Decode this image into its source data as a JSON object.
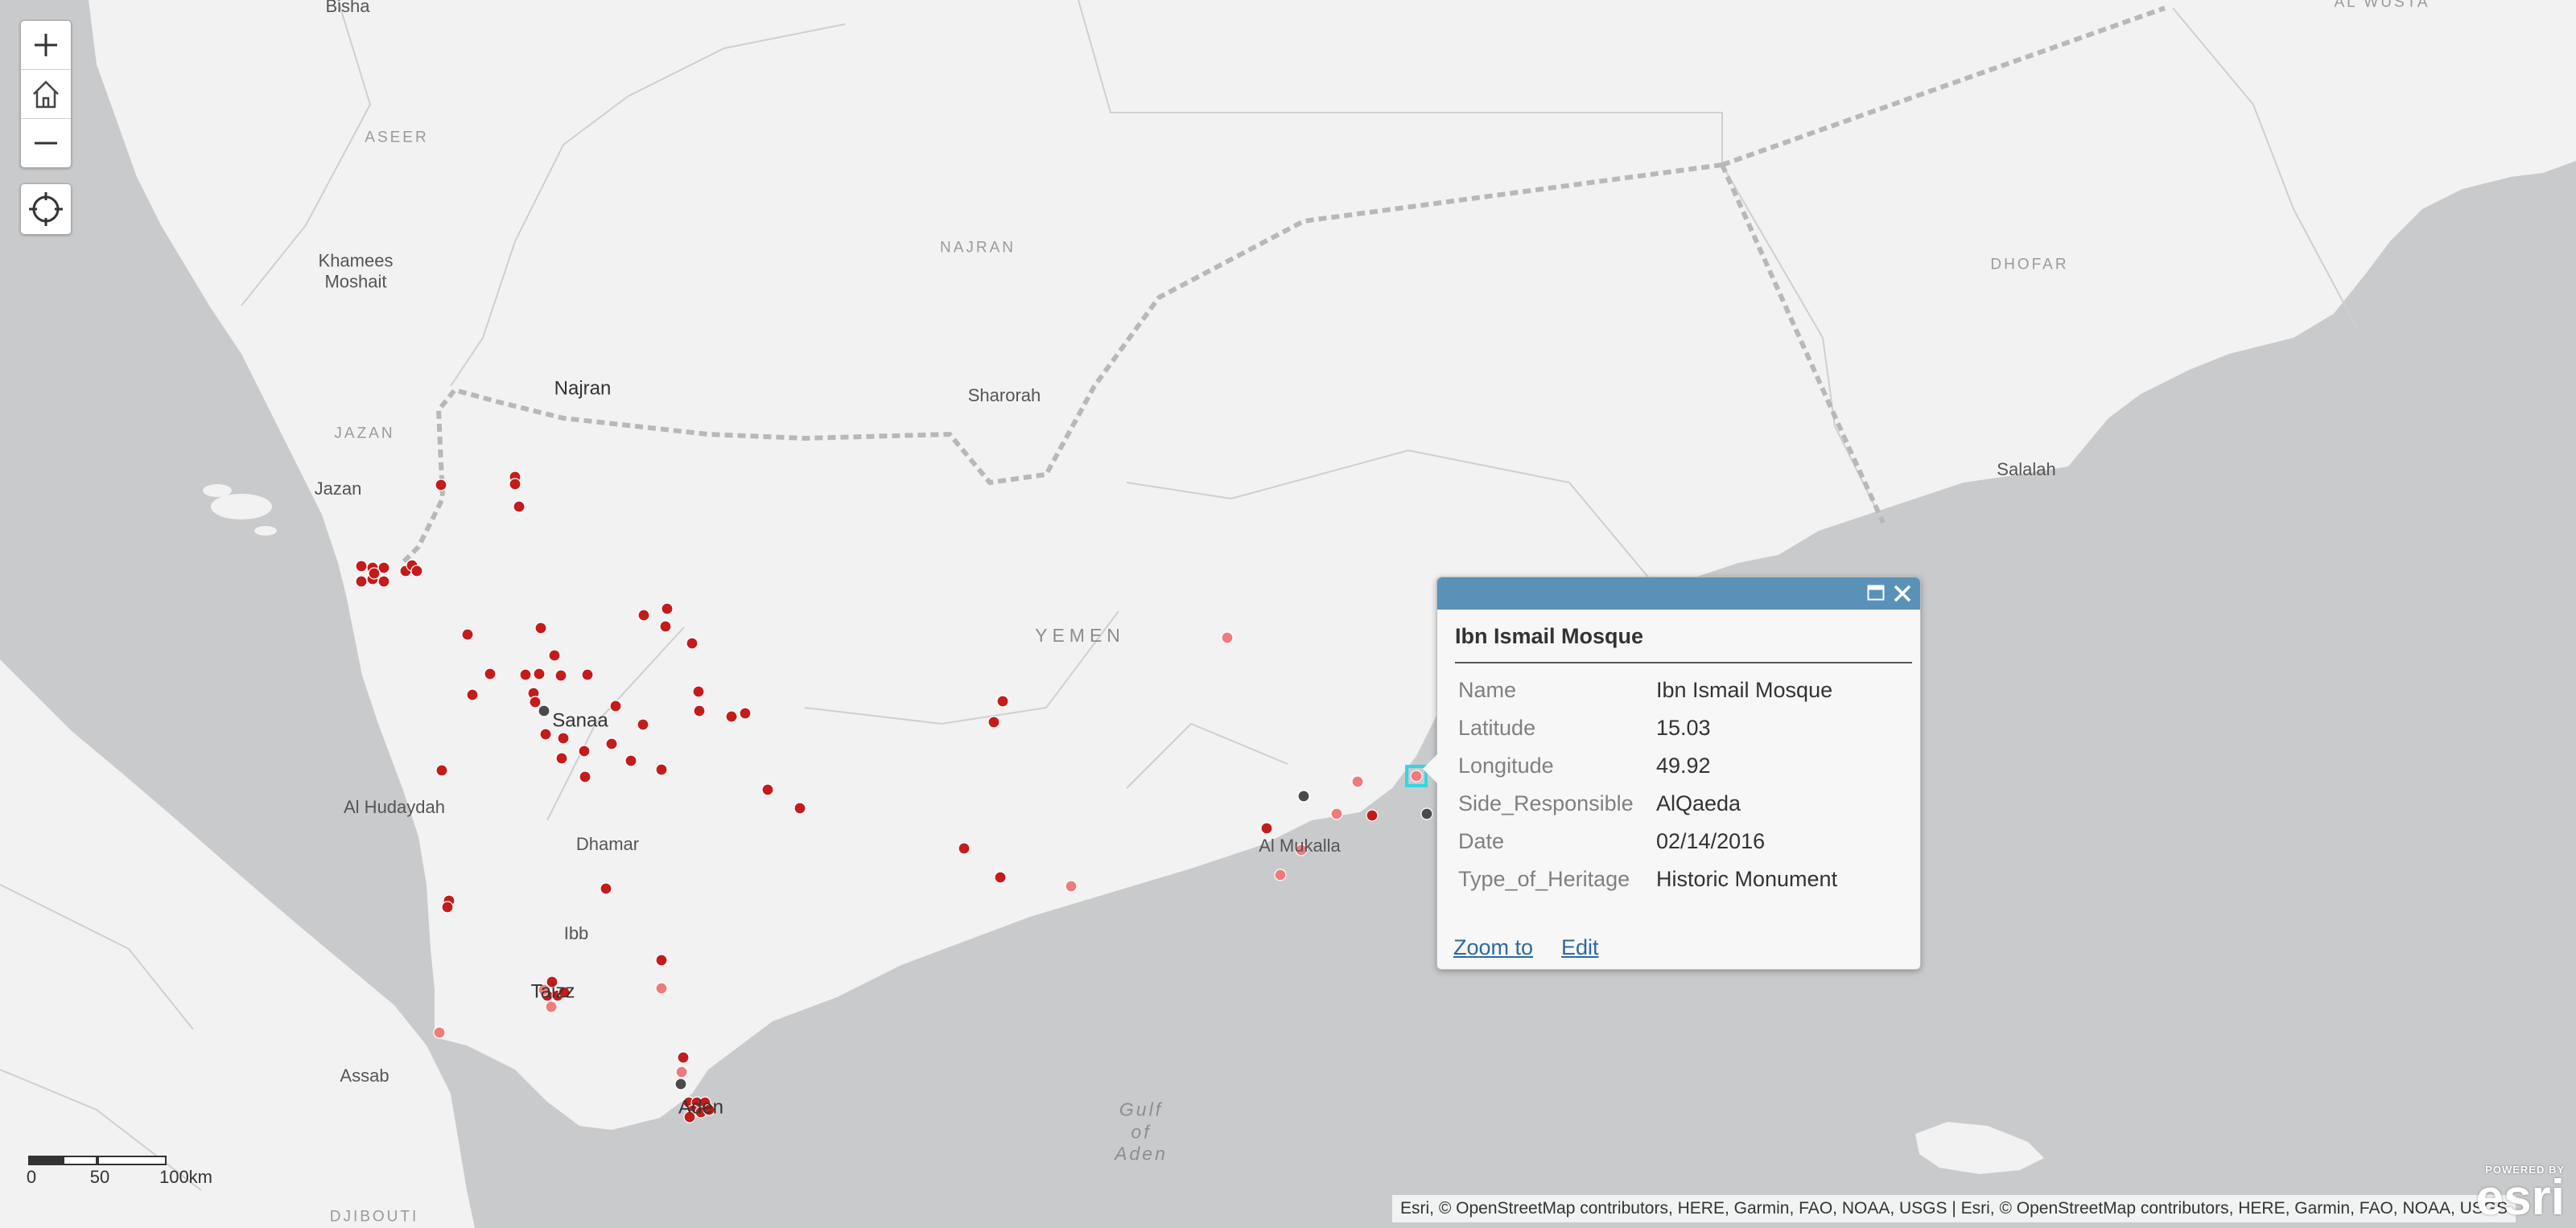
{
  "map": {
    "colors": {
      "land": "#f2f2f2",
      "water": "#c8cacc",
      "border": "#c9c9c9",
      "disputed": "#b5b5b5",
      "point_dark_red": "#c41b1b",
      "point_light_red": "#ef7b7b",
      "point_gray": "#4a4a4a",
      "selection": "#33d6e6"
    },
    "labels": {
      "bisha": "Bisha",
      "al_wusta": "AL WUSTA",
      "aseer": "ASEER",
      "khamees_moshait": "Khamees\nMoshait",
      "najran_region": "NAJRAN",
      "dhofar": "DHOFAR",
      "sharorah": "Sharorah",
      "najran_city": "Najran",
      "jazan_region": "JAZAN",
      "jazan_city": "Jazan",
      "salalah": "Salalah",
      "yemen": "YEMEN",
      "sanaa": "Sanaa",
      "al_hudaydah": "Al Hudaydah",
      "dhamar": "Dhamar",
      "al_mukalla": "Al Mukalla",
      "ibb": "Ibb",
      "taizz": "Taizz",
      "assab": "Assab",
      "aden": "Aden",
      "gulf_of_aden": "Gulf\nof\nAden",
      "djibouti": "DJIBOUTI"
    }
  },
  "controls": {
    "zoom_in_icon": "plus-icon",
    "home_icon": "home-icon",
    "zoom_out_icon": "minus-icon",
    "locate_icon": "locate-crosshair-icon"
  },
  "popup": {
    "title": "Ibn Ismail Mosque",
    "fields": [
      {
        "key": "Name",
        "value": "Ibn Ismail Mosque"
      },
      {
        "key": "Latitude",
        "value": "15.03"
      },
      {
        "key": "Longitude",
        "value": "49.92"
      },
      {
        "key": "Side_Responsible",
        "value": "AlQaeda"
      },
      {
        "key": "Date",
        "value": "02/14/2016"
      },
      {
        "key": "Type_of_Heritage",
        "value": "Historic Monument"
      }
    ],
    "zoom_to_label": "Zoom to",
    "edit_label": "Edit",
    "maximize_icon": "maximize-icon",
    "close_icon": "close-icon"
  },
  "scalebar": {
    "labels": [
      "0",
      "50",
      "100km"
    ]
  },
  "attribution": "Esri, © OpenStreetMap contributors, HERE, Garmin, FAO, NOAA, USGS | Esri, © OpenStreetMap contributors, HERE, Garmin, FAO, NOAA, USGS",
  "logo": {
    "powered_by": "POWERED BY",
    "word": "esri"
  }
}
